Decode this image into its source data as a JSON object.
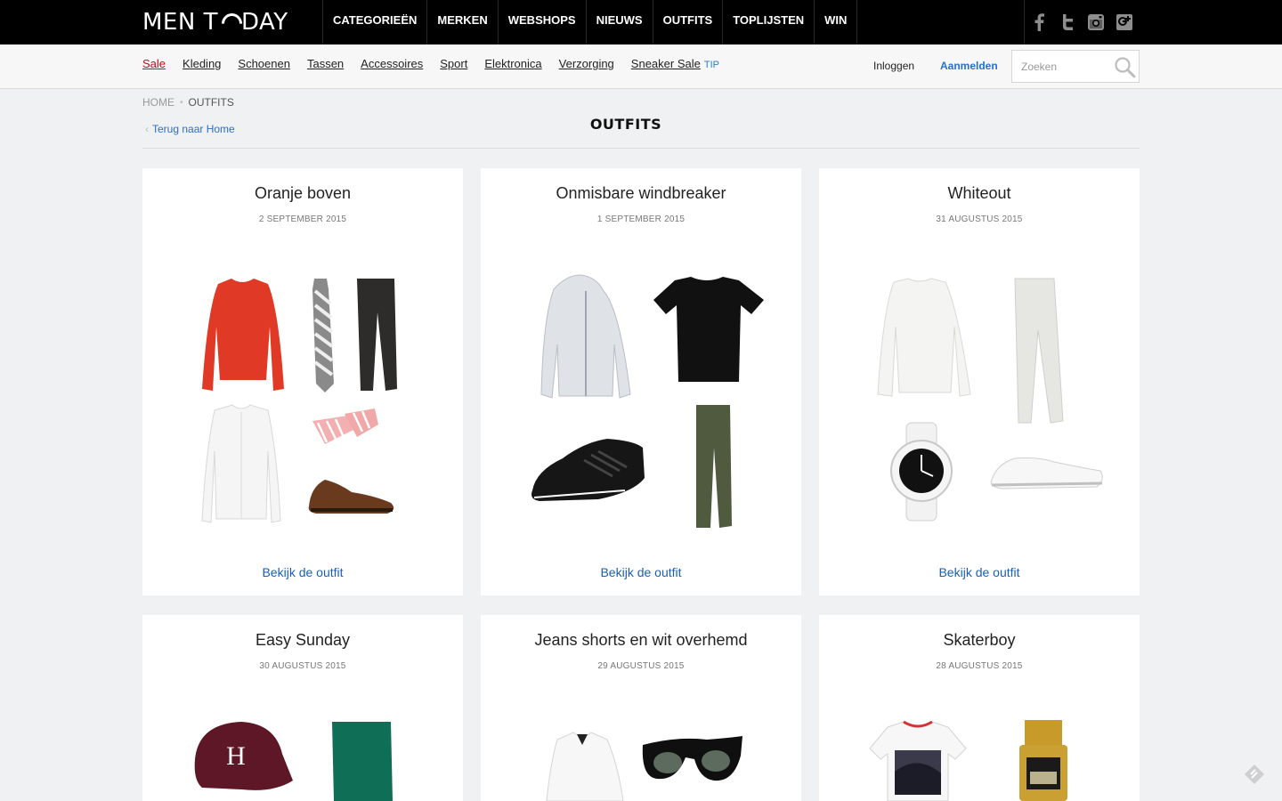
{
  "logo": {
    "part1": "MEN T",
    "part2": "DAY"
  },
  "main_nav": [
    "CATEGORIEËN",
    "MERKEN",
    "WEBSHOPS",
    "NIEUWS",
    "OUTFITS",
    "TOPLIJSTEN",
    "WIN"
  ],
  "social": [
    "facebook-icon",
    "twitter-icon",
    "instagram-icon",
    "google-plus-icon"
  ],
  "sub_nav": {
    "links": [
      "Sale",
      "Kleding",
      "Schoenen",
      "Tassen",
      "Accessoires",
      "Sport",
      "Elektronica",
      "Verzorging",
      "Sneaker Sale"
    ],
    "tip": "TIP",
    "login": "Inloggen",
    "register": "Aanmelden",
    "search_placeholder": "Zoeken"
  },
  "breadcrumb": {
    "home": "HOME",
    "separator": "•",
    "current": "OUTFITS"
  },
  "back_link": "Terug naar Home",
  "page_title": "OUTFITS",
  "cta_label": "Bekijk de outfit",
  "outfits": [
    {
      "title": "Oranje boven",
      "date": "2 SEPTEMBER 2015"
    },
    {
      "title": "Onmisbare windbreaker",
      "date": "1 SEPTEMBER 2015"
    },
    {
      "title": "Whiteout",
      "date": "31 AUGUSTUS 2015"
    },
    {
      "title": "Easy Sunday",
      "date": "30 AUGUSTUS 2015"
    },
    {
      "title": "Jeans shorts en wit overhemd",
      "date": "29 AUGUSTUS 2015"
    },
    {
      "title": "Skaterboy",
      "date": "28 AUGUSTUS 2015"
    }
  ],
  "colors": {
    "brand_blue": "#1a5fb4",
    "sale_red": "#d0021b",
    "topbar": "#000000"
  }
}
